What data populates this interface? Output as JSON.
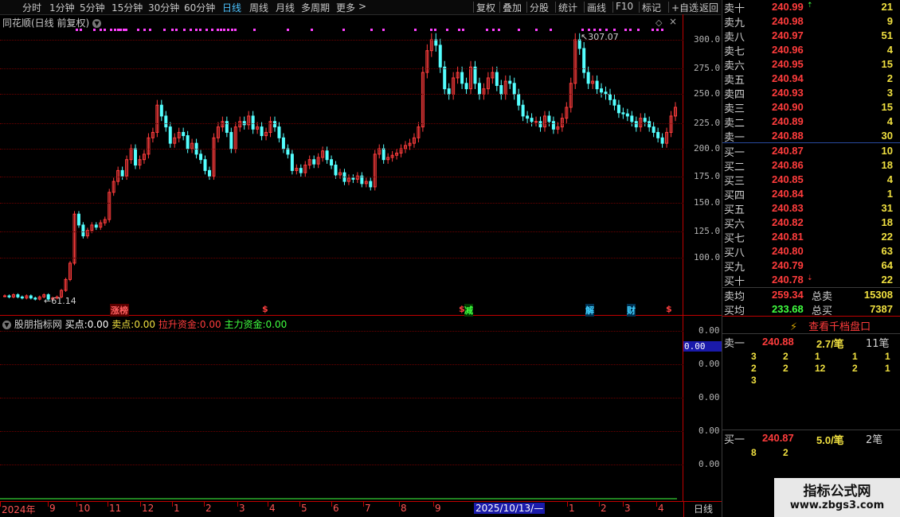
{
  "toolbar": {
    "periods": [
      "分时",
      "1分钟",
      "5分钟",
      "15分钟",
      "30分钟",
      "60分钟",
      "日线",
      "周线",
      "月线",
      "多周期",
      "更多"
    ],
    "active_period": "日线",
    "more_arrow": ">",
    "actions": [
      "复权",
      "叠加",
      "分股",
      "统计",
      "画线",
      "F10",
      "标记",
      "+自选",
      "返回"
    ]
  },
  "chart": {
    "title": "同花顺(日线 前复权)",
    "y_ticks": [
      "300.0",
      "275.0",
      "250.0",
      "225.0",
      "200.0",
      "175.0",
      "150.0",
      "125.0",
      "100.0"
    ],
    "high_label": "307.07",
    "low_label": "61.14",
    "event_marks": [
      {
        "text": "涨榜",
        "color": "#ff4040"
      },
      {
        "text": "$",
        "color": "#ff4040"
      },
      {
        "text": "$",
        "color": "#ff4040"
      },
      {
        "text": "减",
        "color": "#40ff40"
      },
      {
        "text": "解",
        "color": "#40d0ff"
      },
      {
        "text": "财",
        "color": "#40d0ff"
      },
      {
        "text": "$",
        "color": "#ff4040"
      }
    ]
  },
  "indicator": {
    "name": "股朋指标网",
    "buy_label": "买点:",
    "buy_value": "0.00",
    "sell_label": "卖点:",
    "sell_value": "0.00",
    "pull_label": "拉升资金:",
    "pull_value": "0.00",
    "main_label": "主力资金:",
    "main_value": "0.00",
    "y_ticks": [
      "0.00",
      "0.00",
      "0.00",
      "0.00",
      "0.00"
    ],
    "current_value": "0.00"
  },
  "x_axis": {
    "labels": [
      "2024年",
      "9",
      "10",
      "11",
      "12",
      "1",
      "2",
      "3",
      "4",
      "5",
      "6",
      "7",
      "8",
      "9",
      "2025/10/13/—",
      "1",
      "2",
      "3",
      "4"
    ],
    "period_button": "日线"
  },
  "order_book": {
    "asks": [
      {
        "label": "卖十",
        "price": "240.99",
        "vol": "21"
      },
      {
        "label": "卖九",
        "price": "240.98",
        "vol": "9"
      },
      {
        "label": "卖八",
        "price": "240.97",
        "vol": "51"
      },
      {
        "label": "卖七",
        "price": "240.96",
        "vol": "4"
      },
      {
        "label": "卖六",
        "price": "240.95",
        "vol": "15"
      },
      {
        "label": "卖五",
        "price": "240.94",
        "vol": "2"
      },
      {
        "label": "卖四",
        "price": "240.93",
        "vol": "3"
      },
      {
        "label": "卖三",
        "price": "240.90",
        "vol": "15"
      },
      {
        "label": "卖二",
        "price": "240.89",
        "vol": "4"
      },
      {
        "label": "卖一",
        "price": "240.88",
        "vol": "30"
      }
    ],
    "bids": [
      {
        "label": "买一",
        "price": "240.87",
        "vol": "10"
      },
      {
        "label": "买二",
        "price": "240.86",
        "vol": "18"
      },
      {
        "label": "买三",
        "price": "240.85",
        "vol": "4"
      },
      {
        "label": "买四",
        "price": "240.84",
        "vol": "1"
      },
      {
        "label": "买五",
        "price": "240.83",
        "vol": "31"
      },
      {
        "label": "买六",
        "price": "240.82",
        "vol": "18"
      },
      {
        "label": "买七",
        "price": "240.81",
        "vol": "22"
      },
      {
        "label": "买八",
        "price": "240.80",
        "vol": "63"
      },
      {
        "label": "买九",
        "price": "240.79",
        "vol": "64"
      },
      {
        "label": "买十",
        "price": "240.78",
        "vol": "22"
      }
    ],
    "sell_avg_label": "卖均",
    "sell_avg": "259.34",
    "total_sell_label": "总卖",
    "total_sell": "15308",
    "buy_avg_label": "买均",
    "buy_avg": "233.68",
    "total_buy_label": "总买",
    "total_buy": "7387",
    "view_button": "查看千档盘口",
    "queue_sell": {
      "label": "卖一",
      "price": "240.88",
      "per": "2.7/笔",
      "count": "11笔",
      "rows": [
        [
          "3",
          "2",
          "1",
          "1",
          "1"
        ],
        [
          "2",
          "2",
          "12",
          "2",
          "1"
        ],
        [
          "3"
        ]
      ]
    },
    "queue_buy": {
      "label": "买一",
      "price": "240.87",
      "per": "5.0/笔",
      "count": "2笔",
      "rows": [
        [
          "8",
          "2"
        ]
      ]
    }
  },
  "watermark": {
    "title": "指标公式网",
    "url": "www.zbgs3.com"
  },
  "colors": {
    "up": "#ff3c3c",
    "down": "#54ffff",
    "grid": "#8a0000",
    "accent": "#4cc3ff",
    "magenta": "#ff40ff"
  },
  "chart_data": {
    "type": "candlestick",
    "ylim": [
      61,
      307
    ],
    "annotations": {
      "max": 307.07,
      "min": 61.14
    },
    "closes": [
      65,
      64,
      66,
      64,
      63,
      65,
      63,
      62,
      64,
      66,
      62,
      63,
      64,
      70,
      80,
      95,
      140,
      130,
      120,
      125,
      130,
      128,
      132,
      135,
      160,
      170,
      180,
      175,
      190,
      200,
      185,
      190,
      195,
      210,
      215,
      240,
      230,
      220,
      205,
      210,
      215,
      212,
      200,
      205,
      195,
      190,
      180,
      175,
      210,
      220,
      225,
      215,
      200,
      220,
      225,
      222,
      230,
      218,
      220,
      212,
      215,
      225,
      220,
      210,
      200,
      195,
      180,
      182,
      178,
      185,
      190,
      186,
      192,
      198,
      190,
      185,
      176,
      178,
      170,
      173,
      172,
      175,
      168,
      170,
      165,
      195,
      200,
      190,
      192,
      194,
      196,
      200,
      203,
      205,
      210,
      220,
      270,
      290,
      300,
      295,
      275,
      255,
      250,
      265,
      270,
      260,
      255,
      275,
      260,
      250,
      255,
      265,
      270,
      258,
      250,
      262,
      260,
      250,
      240,
      230,
      228,
      225,
      225,
      220,
      230,
      225,
      218,
      220,
      228,
      238,
      260,
      300,
      292,
      270,
      260,
      262,
      255,
      252,
      250,
      245,
      240,
      233,
      232,
      230,
      225,
      220,
      228,
      225,
      220,
      215,
      210,
      205,
      215,
      230,
      238
    ]
  }
}
